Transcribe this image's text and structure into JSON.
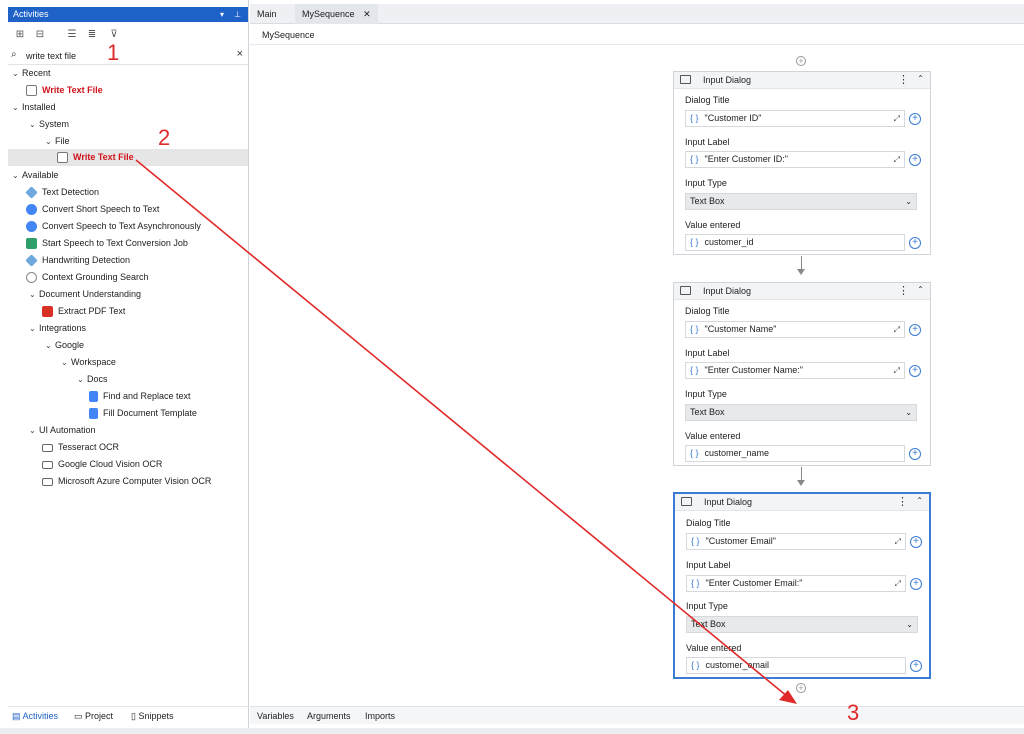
{
  "activities_panel": {
    "title": "Activities",
    "search": {
      "value": "write text file",
      "placeholder": ""
    },
    "tree": {
      "recent": {
        "label": "Recent",
        "items": [
          "Write Text File"
        ]
      },
      "installed": {
        "label": "Installed",
        "system": "System",
        "file": "File",
        "items": [
          "Write Text File"
        ]
      },
      "available": {
        "label": "Available",
        "items": [
          "Text Detection",
          "Convert Short Speech to Text",
          "Convert Speech to Text Asynchronously",
          "Start Speech to Text Conversion Job",
          "Handwriting Detection",
          "Context Grounding Search"
        ],
        "doc_understanding": {
          "label": "Document Understanding",
          "items": [
            "Extract PDF Text"
          ]
        },
        "integrations": {
          "label": "Integrations",
          "google": "Google",
          "workspace": "Workspace",
          "docs": "Docs",
          "items": [
            "Find and Replace text",
            "Fill Document Template"
          ]
        },
        "ui_automation": {
          "label": "UI Automation",
          "items": [
            "Tesseract OCR",
            "Google Cloud Vision OCR",
            "Microsoft Azure Computer Vision OCR"
          ]
        }
      }
    },
    "bottom_tabs": [
      "Activities",
      "Project",
      "Snippets"
    ]
  },
  "designer": {
    "tabs": [
      "Main",
      "MySequence"
    ],
    "breadcrumb": "MySequence",
    "bottom_tabs": [
      "Variables",
      "Arguments",
      "Imports"
    ],
    "cards": [
      {
        "title": "Input Dialog",
        "dialog_title_label": "Dialog Title",
        "dialog_title": "\"Customer ID\"",
        "input_label_label": "Input Label",
        "input_label": "\"Enter Customer ID:\"",
        "input_type_label": "Input Type",
        "input_type": "Text Box",
        "value_label": "Value entered",
        "value": "customer_id"
      },
      {
        "title": "Input Dialog",
        "dialog_title_label": "Dialog Title",
        "dialog_title": "\"Customer Name\"",
        "input_label_label": "Input Label",
        "input_label": "\"Enter Customer Name:\"",
        "input_type_label": "Input Type",
        "input_type": "Text Box",
        "value_label": "Value entered",
        "value": "customer_name"
      },
      {
        "title": "Input Dialog",
        "dialog_title_label": "Dialog Title",
        "dialog_title": "\"Customer Email\"",
        "input_label_label": "Input Label",
        "input_label": "\"Enter Customer Email:\"",
        "input_type_label": "Input Type",
        "input_type": "Text Box",
        "value_label": "Value entered",
        "value": "customer_email"
      }
    ]
  },
  "annotations": [
    "1",
    "2",
    "3"
  ],
  "colors": {
    "accent": "#1e62c8",
    "annotation": "#e02a2a",
    "highlight_text": "#d0131b"
  }
}
